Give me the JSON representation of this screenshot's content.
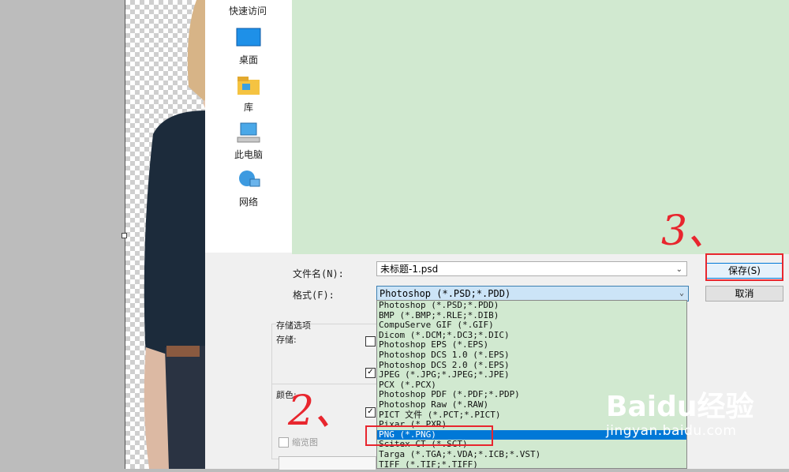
{
  "quick_access": {
    "title": "快速访问",
    "items": [
      {
        "label": "桌面",
        "icon": "desktop-icon"
      },
      {
        "label": "库",
        "icon": "library-icon"
      },
      {
        "label": "此电脑",
        "icon": "computer-icon"
      },
      {
        "label": "网络",
        "icon": "network-icon"
      }
    ]
  },
  "save_form": {
    "filename_label": "文件名(N):",
    "filename_value": "未标题-1.psd",
    "format_label": "格式(F):",
    "format_value": "Photoshop (*.PSD;*.PDD)",
    "save_button": "保存(S)",
    "cancel_button": "取消"
  },
  "options": {
    "group_label": "存储选项",
    "store_label": "存储:",
    "color_label": "颜色:",
    "thumbnail_label": "缩览图"
  },
  "format_list": [
    "Photoshop (*.PSD;*.PDD)",
    "BMP (*.BMP;*.RLE;*.DIB)",
    "CompuServe GIF (*.GIF)",
    "Dicom (*.DCM;*.DC3;*.DIC)",
    "Photoshop EPS (*.EPS)",
    "Photoshop DCS 1.0 (*.EPS)",
    "Photoshop DCS 2.0 (*.EPS)",
    "JPEG (*.JPG;*.JPEG;*.JPE)",
    "PCX (*.PCX)",
    "Photoshop PDF (*.PDF;*.PDP)",
    "Photoshop Raw (*.RAW)",
    "PICT 文件 (*.PCT;*.PICT)",
    "Pixar (*.PXR)",
    "PNG (*.PNG)",
    "Scitex CT (*.SCT)",
    "Targa (*.TGA;*.VDA;*.ICB;*.VST)",
    "TIFF (*.TIF;*.TIFF)"
  ],
  "selected_format_index": 13,
  "annotations": {
    "step2": "2、",
    "step3": "3、"
  },
  "watermark": {
    "brand": "Baidu经验",
    "url": "jingyan.baidu.com"
  },
  "colors": {
    "accent": "#0078d7",
    "preview_bg": "#d1e9d0",
    "annotation_red": "#e8262e"
  }
}
